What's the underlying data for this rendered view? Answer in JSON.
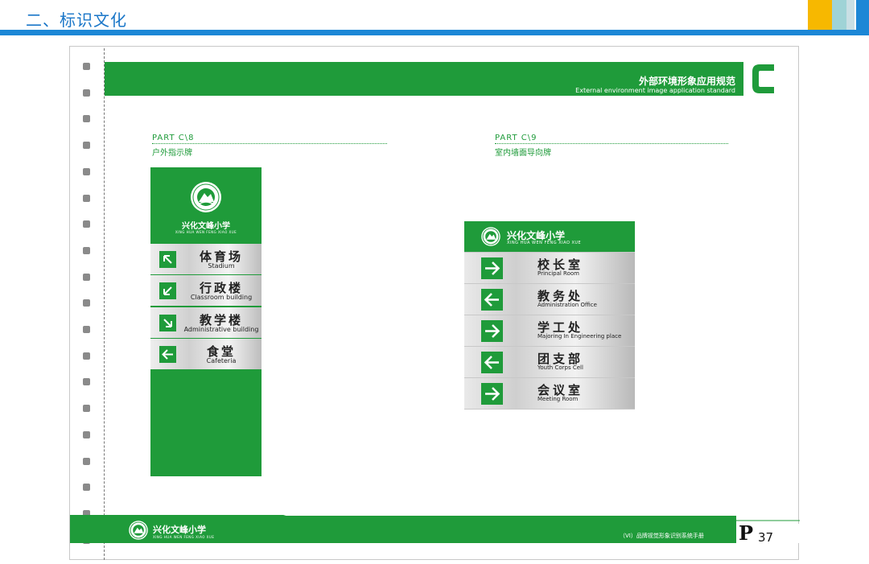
{
  "header": {
    "title": "二、标识文化"
  },
  "colors": {
    "brand_green": "#1f9b3a",
    "header_blue": "#1c87d6",
    "header_yellow": "#f7b800",
    "header_teal": "#9fd3d6"
  },
  "banner": {
    "title_cn": "外部环境形象应用规范",
    "title_en": "External environment image application standard",
    "section_letter": "C"
  },
  "parts": [
    {
      "code": "PART    C\\8",
      "title": "户外指示牌"
    },
    {
      "code": "PART    C\\9",
      "title": "室内墙面导向牌"
    }
  ],
  "school": {
    "name": "兴化文峰小学",
    "pinyin": "XING HUA WEN FENG XIAO XUE"
  },
  "outdoor_sign": {
    "rows": [
      {
        "cn": "体育场",
        "en": "Stadium",
        "icon": "arrow-up-left-icon"
      },
      {
        "cn": "行政楼",
        "en": "Classroom building",
        "icon": "arrow-down-left-icon"
      },
      {
        "cn": "教学楼",
        "en": "Administrative building",
        "icon": "arrow-down-right-icon"
      },
      {
        "cn": "食堂",
        "en": "Cafeteria",
        "icon": "arrow-left-icon"
      }
    ]
  },
  "indoor_sign": {
    "rows": [
      {
        "cn": "校长室",
        "en": "Principal Room",
        "icon": "arrow-right-icon"
      },
      {
        "cn": "教务处",
        "en": "Administration Office",
        "icon": "arrow-left-icon"
      },
      {
        "cn": "学工处",
        "en": "Majoring In Engineering place",
        "icon": "arrow-right-icon"
      },
      {
        "cn": "团支部",
        "en": "Youth Corps Cell",
        "icon": "arrow-left-icon"
      },
      {
        "cn": "会议室",
        "en": "Meeting Room",
        "icon": "arrow-right-icon"
      }
    ]
  },
  "footer": {
    "manual_title": "（VI）品牌视觉形象识别系统手册",
    "page_letter": "P",
    "page_number": "37"
  }
}
